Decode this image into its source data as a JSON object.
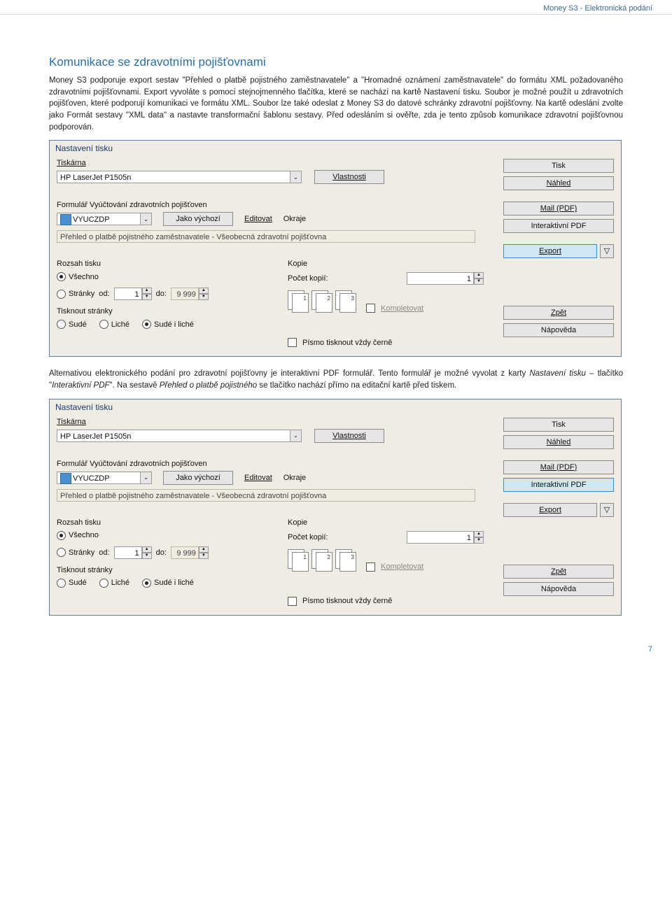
{
  "header": {
    "title": "Money S3 - Elektronická podání"
  },
  "section": {
    "title": "Komunikace se zdravotními pojišťovnami",
    "para1": "Money S3 podporuje export sestav \"Přehled o platbě pojistného zaměstnavatele\" a \"Hromadné oznámení zaměstnavatele\" do formátu XML požadovaného zdravotními pojišťovnami. Export vyvoláte s pomocí stejnojmenného tlačítka, které se nachází na kartě Nastavení tisku. Soubor je možné použít u zdravotních pojišťoven, které podporují komunikaci ve formátu XML. Soubor lze také odeslat z Money S3 do datové schránky zdravotní pojišťovny. Na kartě odeslání zvolte jako Formát sestavy \"XML data\" a nastavte transformační šablonu sestavy. Před odesláním si ověřte, zda je tento způsob komunikace zdravotní pojišťovnou podporován.",
    "para2_a": "Alternativou elektronického podání pro zdravotní pojišťovny je interaktivní PDF formulář. Tento formulář je možné vyvolat z karty ",
    "para2_b": "Nastavení tisku",
    "para2_c": " – tlačítko \"",
    "para2_d": "Interaktivní PDF",
    "para2_e": "\". Na sestavě ",
    "para2_f": "Přehled o platbě pojistného",
    "para2_g": " se tlačítko nachází přímo na editační kartě před tiskem."
  },
  "dlg": {
    "title": "Nastavení tisku",
    "tiskarna_label": "Tiskárna",
    "tiskarna_value": "HP LaserJet P1505n",
    "vlastnosti": "Vlastnosti",
    "form_label": "Formulář  Vyúčtování zdravotních pojišťoven",
    "form_value": "VYUCZDP",
    "jako_vychozi": "Jako výchozí",
    "editovat": "Editovat",
    "okraje": "Okraje",
    "desc": "Přehled o platbě pojistného zaměstnavatele - Všeobecná zdravotní pojišťovna",
    "rozsah": "Rozsah tisku",
    "vsechno": "Všechno",
    "stranky": "Stránky",
    "od": "od:",
    "od_val": "1",
    "do": "do:",
    "do_val": "9 999",
    "tisknout": "Tisknout stránky",
    "sude": "Sudé",
    "liche": "Liché",
    "sudeliche": "Sudé i liché",
    "kopie": "Kopie",
    "pocet": "Počet kopií:",
    "pocet_val": "1",
    "kompletovat": "Kompletovat",
    "pismo": "Písmo tisknout vždy černě",
    "side": {
      "tisk": "Tisk",
      "nahled": "Náhled",
      "mail": "Mail (PDF)",
      "interaktivni": "Interaktivní PDF",
      "export": "Export",
      "export_arrow": "▽",
      "zpet": "Zpět",
      "napoveda": "Nápověda"
    }
  },
  "footer": {
    "page": "7"
  }
}
